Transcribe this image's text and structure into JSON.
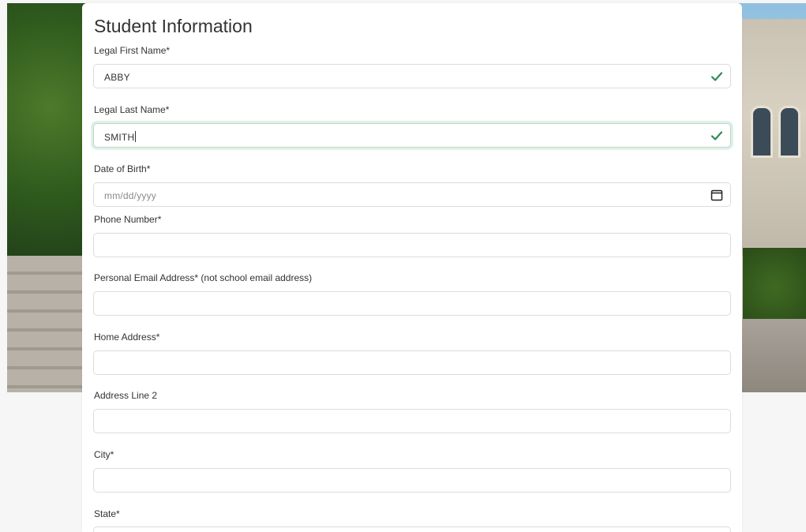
{
  "form": {
    "title": "Student Information",
    "fields": [
      {
        "label": "Legal First Name*",
        "value": "ABBY",
        "valid": true
      },
      {
        "label": "Legal Last Name*",
        "value": "SMITH",
        "valid": true,
        "focused": true
      },
      {
        "label": "Date of Birth*",
        "value": "",
        "placeholder": "mm/dd/yyyy"
      },
      {
        "label": "Phone Number*",
        "value": ""
      },
      {
        "label": "Personal Email Address* (not school email address)",
        "value": ""
      },
      {
        "label": "Home Address*",
        "value": ""
      },
      {
        "label": "Address Line 2",
        "value": ""
      },
      {
        "label": "City*",
        "value": ""
      },
      {
        "label": "State*",
        "value": ""
      }
    ]
  },
  "colors": {
    "valid_check": "#2e8b57",
    "focus_ring": "#a8d6bc"
  },
  "icons": {
    "valid": "check-icon",
    "date": "calendar-icon"
  }
}
